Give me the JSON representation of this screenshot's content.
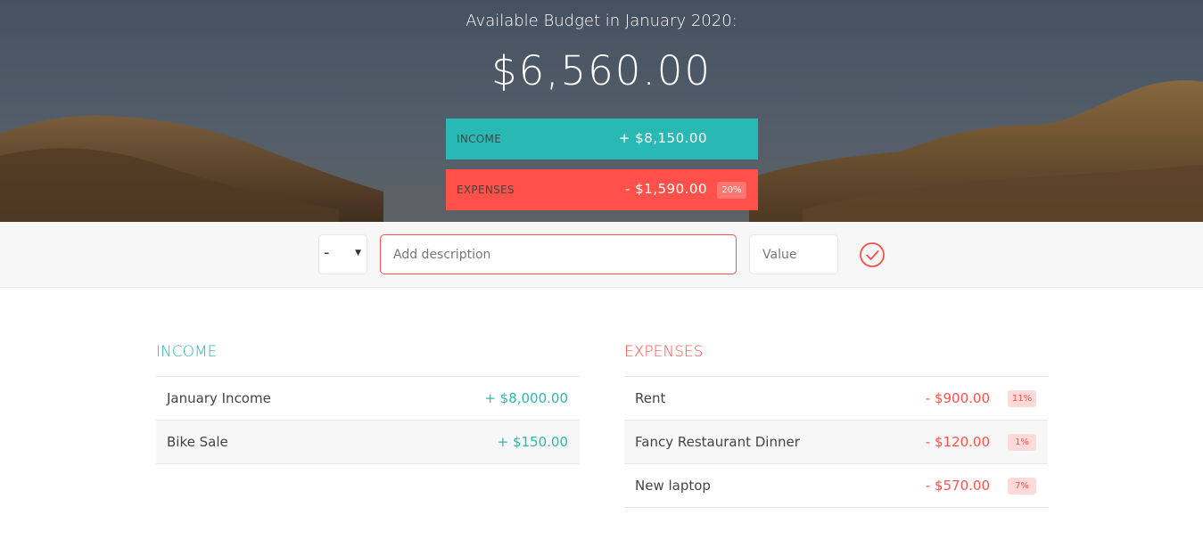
{
  "header": {
    "title": "Available Budget in January 2020:",
    "available_budget": "$6,560.00",
    "income_label": "Income",
    "income_value": "+ $8,150.00",
    "expenses_label": "Expenses",
    "expenses_value": "- $1,590.00",
    "expenses_percentage": "20%"
  },
  "add": {
    "type_selected": "-",
    "description_placeholder": "Add description",
    "value_placeholder": "Value",
    "submit_icon": "check-circle-icon"
  },
  "income": {
    "title": "Income",
    "items": [
      {
        "description": "January Income",
        "value": "+ $8,000.00"
      },
      {
        "description": "Bike Sale",
        "value": "+ $150.00"
      }
    ]
  },
  "expenses": {
    "title": "Expenses",
    "items": [
      {
        "description": "Rent",
        "value": "- $900.00",
        "percentage": "11%"
      },
      {
        "description": "Fancy Restaurant Dinner",
        "value": "- $120.00",
        "percentage": "1%"
      },
      {
        "description": "New laptop",
        "value": "- $570.00",
        "percentage": "7%"
      }
    ]
  },
  "colors": {
    "income": "#28b9b5",
    "expenses": "#ff5049",
    "percentage_bg": "#ffdad9"
  }
}
